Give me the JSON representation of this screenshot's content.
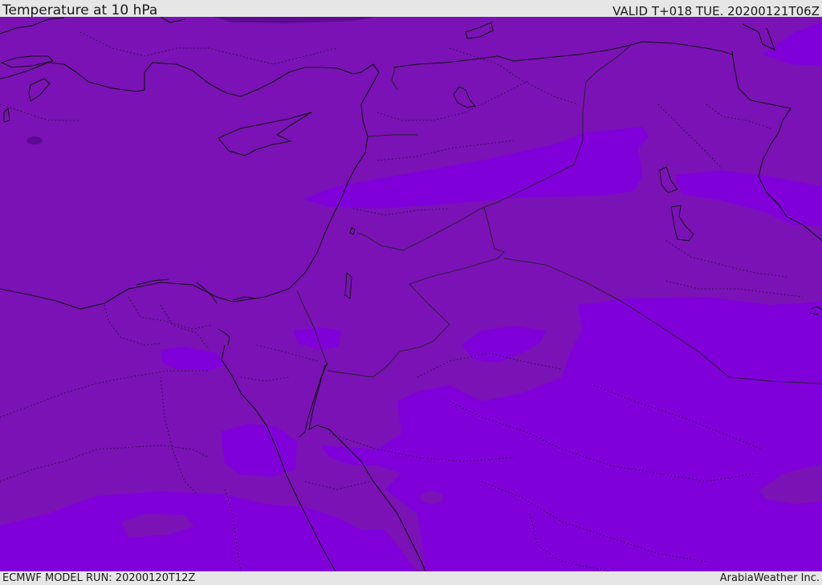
{
  "header": {
    "title": "Temperature at 10 hPa",
    "valid_time": "VALID T+018 TUE. 20200121T06Z"
  },
  "footer": {
    "model_run": "ECMWF MODEL RUN: 20200120T12Z",
    "credit": "ArabiaWeather Inc."
  },
  "colors": {
    "band_dark": "#7a12b6",
    "band_light": "#8000da",
    "band_darkest": "#5e0a96",
    "coast": "#111111",
    "border": "#222222"
  }
}
